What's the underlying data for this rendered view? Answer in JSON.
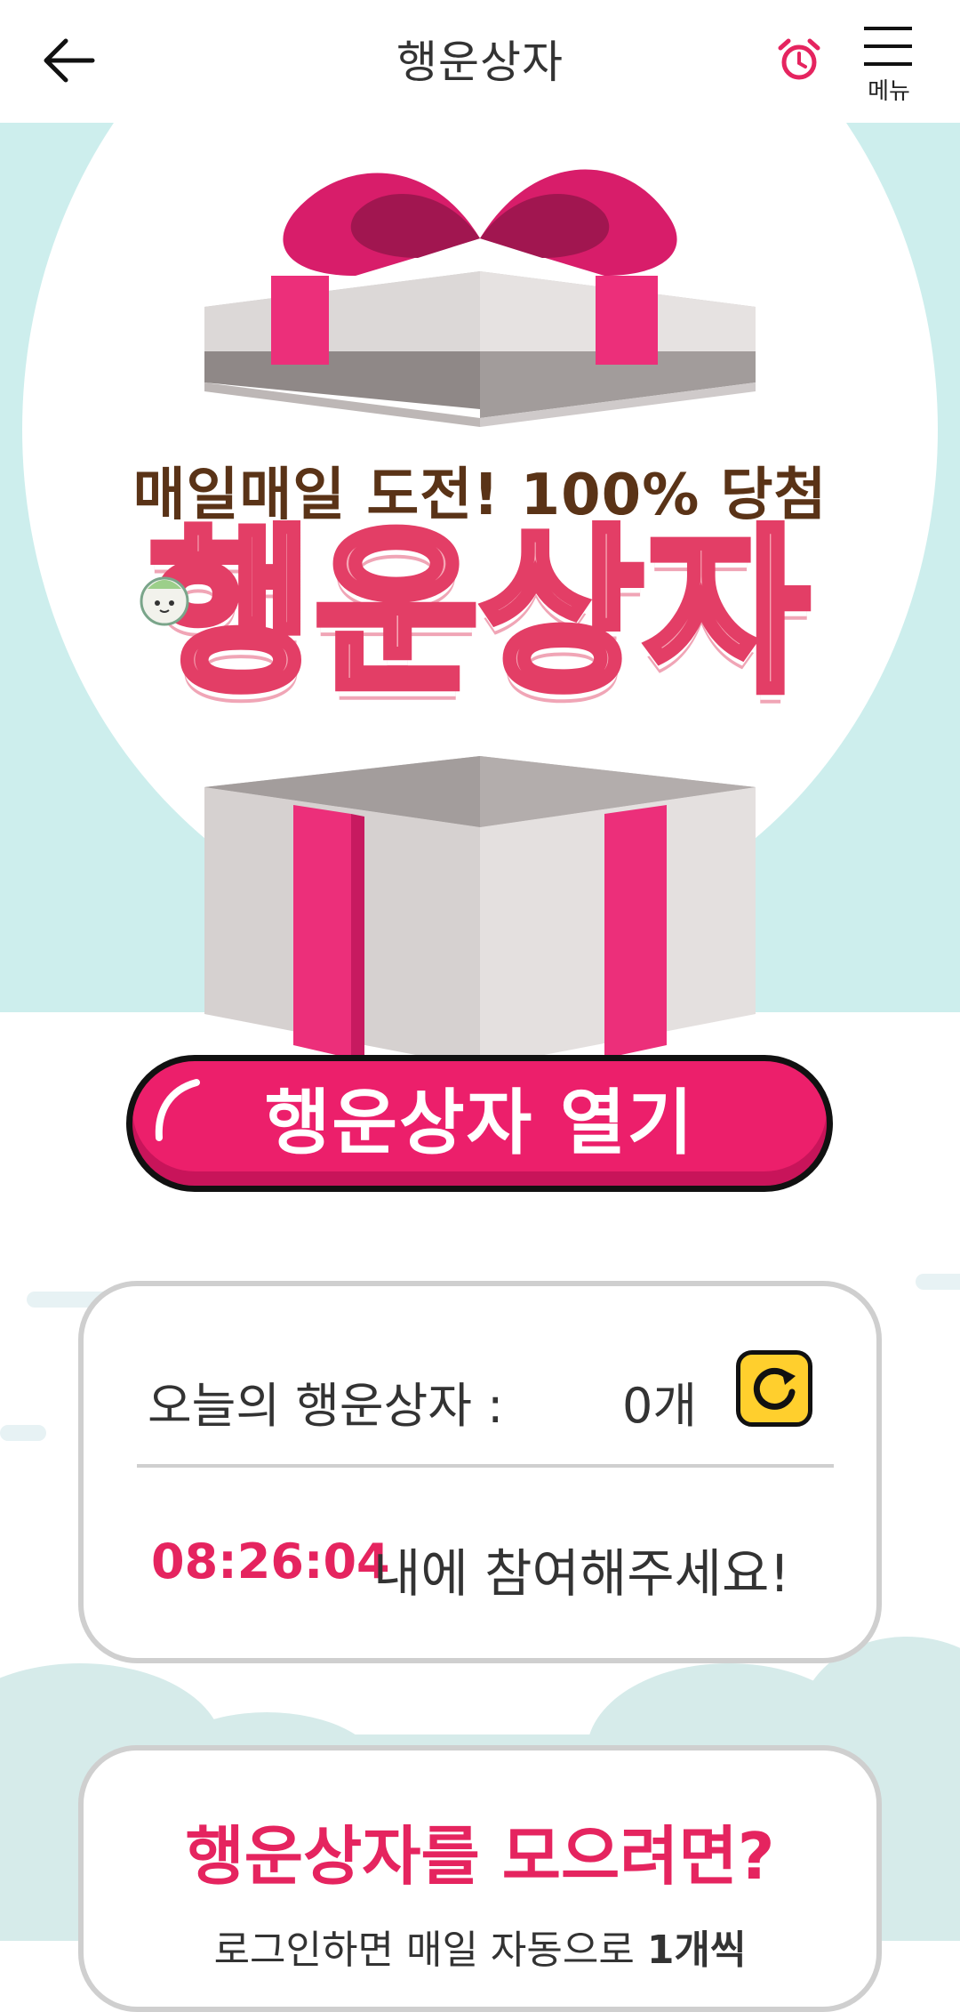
{
  "header": {
    "title": "행운상자",
    "menu_label": "메뉴"
  },
  "hero": {
    "slogan": "매일매일 도전! 100% 당첨",
    "title": "행운상자",
    "open_button": "행운상자 열기"
  },
  "status": {
    "today_label": "오늘의 행운상자 :",
    "today_count": "0개",
    "timer": "08:26:04",
    "timer_message": "내에 참여해주세요!"
  },
  "collect": {
    "title": "행운상자를 모으려면?",
    "desc_prefix": "로그인하면 매일 자동으로 ",
    "desc_bold": "1개씩"
  },
  "colors": {
    "accent": "#ec1f6b",
    "hero_bg": "#cdeeed",
    "refresh": "#ffcf2d"
  },
  "icons": {
    "back": "arrow-left-icon",
    "alarm": "alarm-clock-icon",
    "menu": "hamburger-icon",
    "refresh": "refresh-icon"
  }
}
